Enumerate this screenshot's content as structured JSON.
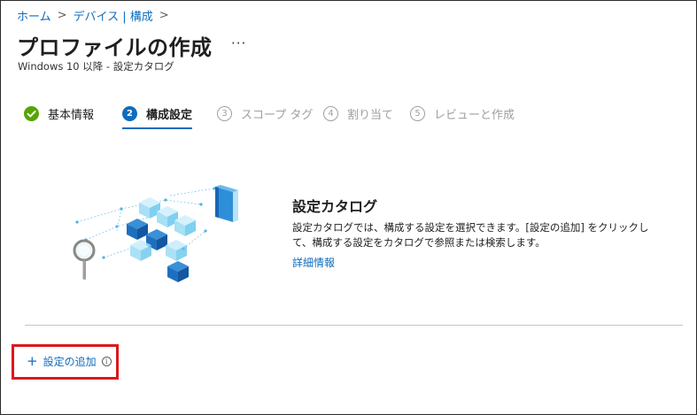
{
  "breadcrumb": {
    "items": [
      "ホーム",
      "デバイス | 構成"
    ],
    "separator": ">"
  },
  "header": {
    "title": "プロファイルの作成",
    "more_label": "···",
    "subtitle": "Windows 10 以降 - 設定カタログ"
  },
  "wizard": {
    "steps": [
      {
        "number": "✓",
        "label": "基本情報",
        "state": "done"
      },
      {
        "number": "2",
        "label": "構成設定",
        "state": "active"
      },
      {
        "number": "3",
        "label": "スコープ タグ",
        "state": "todo"
      },
      {
        "number": "4",
        "label": "割り当て",
        "state": "todo"
      },
      {
        "number": "5",
        "label": "レビューと作成",
        "state": "todo"
      }
    ]
  },
  "catalog": {
    "heading": "設定カタログ",
    "description": "設定カタログでは、構成する設定を選択できます。[設定の追加] をクリックして、構成する設定をカタログで参照または検索します。",
    "learn_more": "詳細情報",
    "illustration_icon": "settings-catalog-illustration"
  },
  "actions": {
    "add_plus": "+",
    "add_label": "設定の追加",
    "info_glyph": "i"
  },
  "colors": {
    "link": "#0f6cbd",
    "done": "#57a300",
    "highlight_box": "#d9191f"
  }
}
